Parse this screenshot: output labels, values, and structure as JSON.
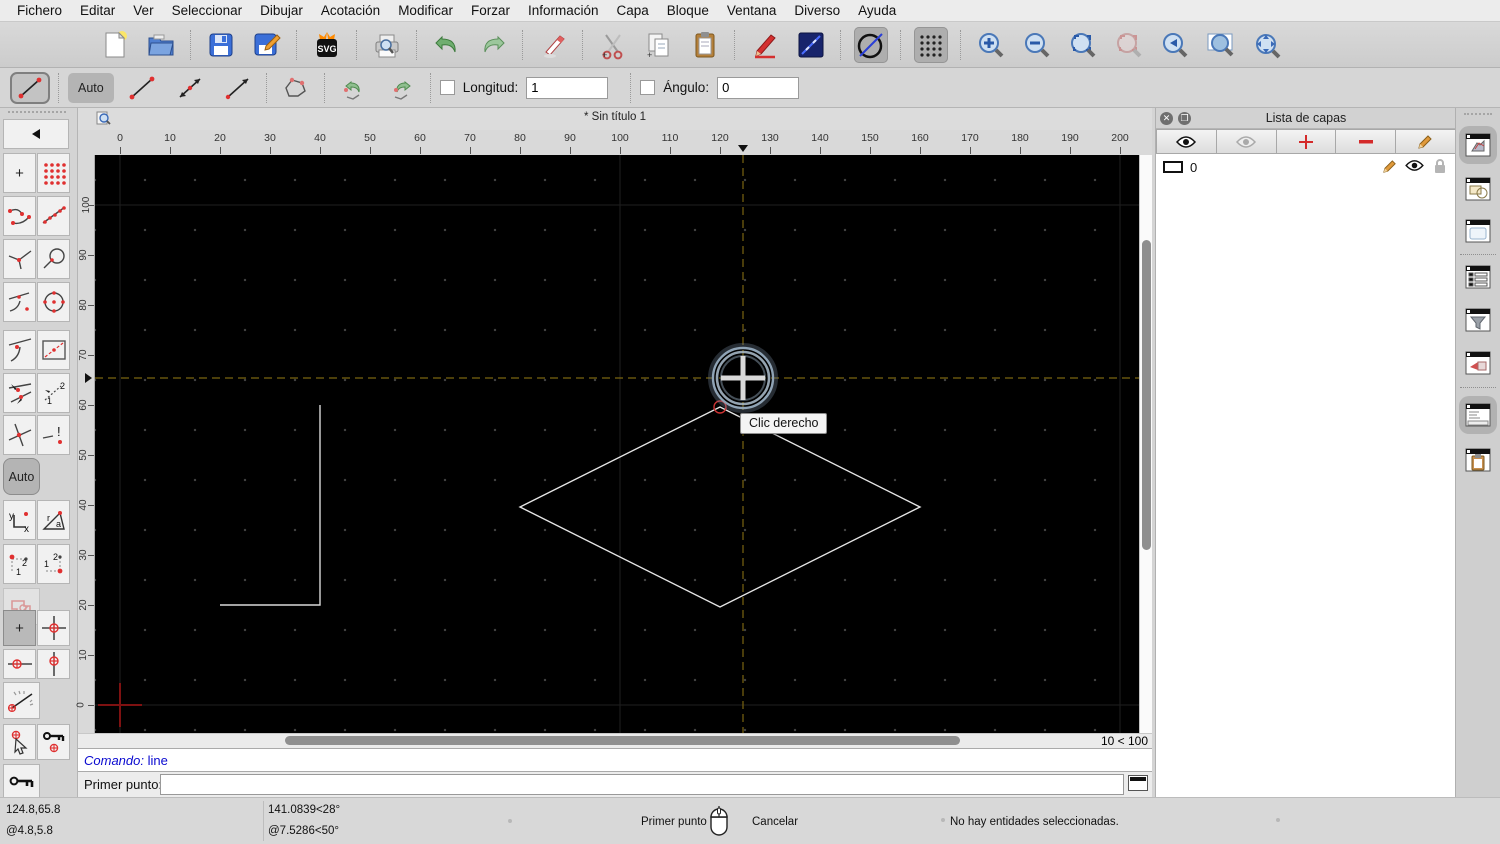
{
  "menu_bar": {
    "items": [
      "Fichero",
      "Editar",
      "Ver",
      "Seleccionar",
      "Dibujar",
      "Acotación",
      "Modificar",
      "Forzar",
      "Información",
      "Capa",
      "Bloque",
      "Ventana",
      "Diverso",
      "Ayuda"
    ]
  },
  "main_toolbar": {
    "icons": [
      "new-document",
      "open-file",
      "save",
      "save-as",
      "export-svg",
      "print-preview",
      "undo",
      "redo",
      "delete-entities",
      "cut",
      "copy",
      "paste",
      "pen-settings",
      "draw-line",
      "draw-circle-line",
      "toggle-grid",
      "zoom-in",
      "zoom-out",
      "zoom-auto",
      "zoom-redraw",
      "zoom-previous",
      "zoom-window",
      "zoom-pan"
    ]
  },
  "tool_options": {
    "auto": "Auto",
    "length_label": "Longitud:",
    "length_value": "1",
    "angle_label": "Ángulo:",
    "angle_value": "0"
  },
  "snap_sidebar": {
    "auto": "Auto"
  },
  "document": {
    "title": "* Sin título 1",
    "h_ruler_labels": [
      "0",
      "10",
      "20",
      "30",
      "40",
      "50",
      "60",
      "70",
      "80",
      "90",
      "100",
      "110",
      "120",
      "130",
      "140",
      "150",
      "160",
      "170",
      "180",
      "190",
      "200"
    ],
    "v_ruler_labels": [
      "0",
      "10",
      "20",
      "30",
      "40",
      "50",
      "60",
      "70",
      "80",
      "90",
      "100"
    ],
    "grid_status": "10 < 100",
    "tooltip": "Clic derecho"
  },
  "layers_panel": {
    "title": "Lista de capas",
    "layers": [
      {
        "name": "0"
      }
    ]
  },
  "command_area": {
    "history_prefix": "Comando:",
    "history_command": "line",
    "prompt_label": "Primer punto:",
    "prompt_value": ""
  },
  "status_bar": {
    "coord_absolute": "124.8,65.8",
    "coord_relative": "@4.8,5.8",
    "polar_absolute": "141.0839<28°",
    "polar_relative": "@7.5286<50°",
    "left_button_action": "Primer punto",
    "right_button_action": "Cancelar",
    "selection_status": "No hay entidades seleccionadas."
  },
  "colors": {
    "canvas_bg": "#000000",
    "crosshair_dashed": "#7a6510",
    "shape_stroke": "#e5e5e5",
    "origin_cross": "#7e1111",
    "snap_indicator": "#cc3333",
    "accent_red": "#d43030",
    "command_text": "#0a0ad0",
    "cursor_ring": "#8fa3b5"
  }
}
